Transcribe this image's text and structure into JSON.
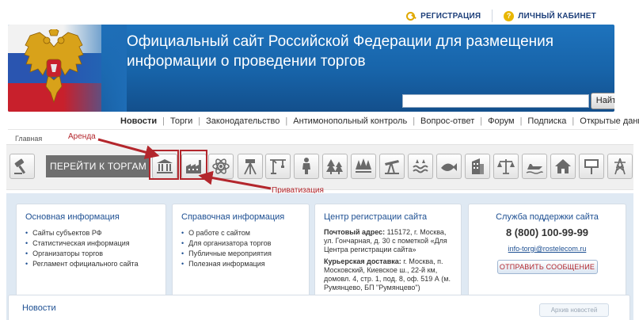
{
  "header": {
    "register_label": "РЕГИСТРАЦИЯ",
    "cabinet_label": "ЛИЧНЫЙ КАБИНЕТ",
    "title_line1": "Официальный сайт Российской Федерации для размещения",
    "title_line2": "информации о проведении торгов",
    "search": {
      "value": "",
      "button_label": "Найти"
    }
  },
  "nav": {
    "items": [
      "Новости",
      "Торги",
      "Законодательство",
      "Антимонопольный контроль",
      "Вопрос-ответ",
      "Форум",
      "Подписка",
      "Открытые данные"
    ],
    "breadcrumb": "Главная"
  },
  "icons_row": {
    "goto_label": "ПЕРЕЙТИ К ТОРГАМ",
    "icon_names": [
      "gavel-icon",
      "bank-building-icon",
      "factory-icon",
      "atom-icon",
      "surveyor-icon",
      "crane-icon",
      "person-icon",
      "forest-icon",
      "trees-icon",
      "oil-pump-icon",
      "water-icon",
      "fish-icon",
      "office-building-icon",
      "scales-icon",
      "jetski-icon",
      "house-icon",
      "billboard-icon",
      "power-line-icon",
      "radio-tower-icon"
    ]
  },
  "annotations": {
    "rent": "Аренда",
    "privatization": "Приватизация",
    "color": "#b3262c"
  },
  "info": {
    "main": {
      "title": "Основная информация",
      "items": [
        "Сайты субъектов РФ",
        "Статистическая информация",
        "Организаторы торгов",
        "Регламент официального сайта"
      ]
    },
    "reference": {
      "title": "Справочная информация",
      "items": [
        "О работе с сайтом",
        "Для организатора торгов",
        "Публичные мероприятия",
        "Полезная информация"
      ]
    },
    "registration": {
      "title": "Центр регистрации сайта",
      "postal_label": "Почтовый адрес:",
      "postal_text": "115172, г. Москва, ул. Гончарная, д. 30 с пометкой «Для Центра регистрации сайта»",
      "courier_label": "Курьерская доставка:",
      "courier_text": "г. Москва, п. Московский, Киевское ш., 22-й км, домовл. 4, стр. 1, под. 8, оф. 519 А (м. Румянцево, БП \"Румянцево\")"
    },
    "support": {
      "title": "Служба поддержки сайта",
      "phone": "8 (800) 100-99-99",
      "email": "info-torgi@rostelecom.ru",
      "send_label": "ОТПРАВИТЬ СООБЩЕНИЕ"
    }
  },
  "news": {
    "title": "Новости",
    "archive_label": "Архив новостей"
  },
  "colors": {
    "banner": "#1763a8",
    "link": "#1d4f92",
    "accent_red": "#b3262c"
  }
}
